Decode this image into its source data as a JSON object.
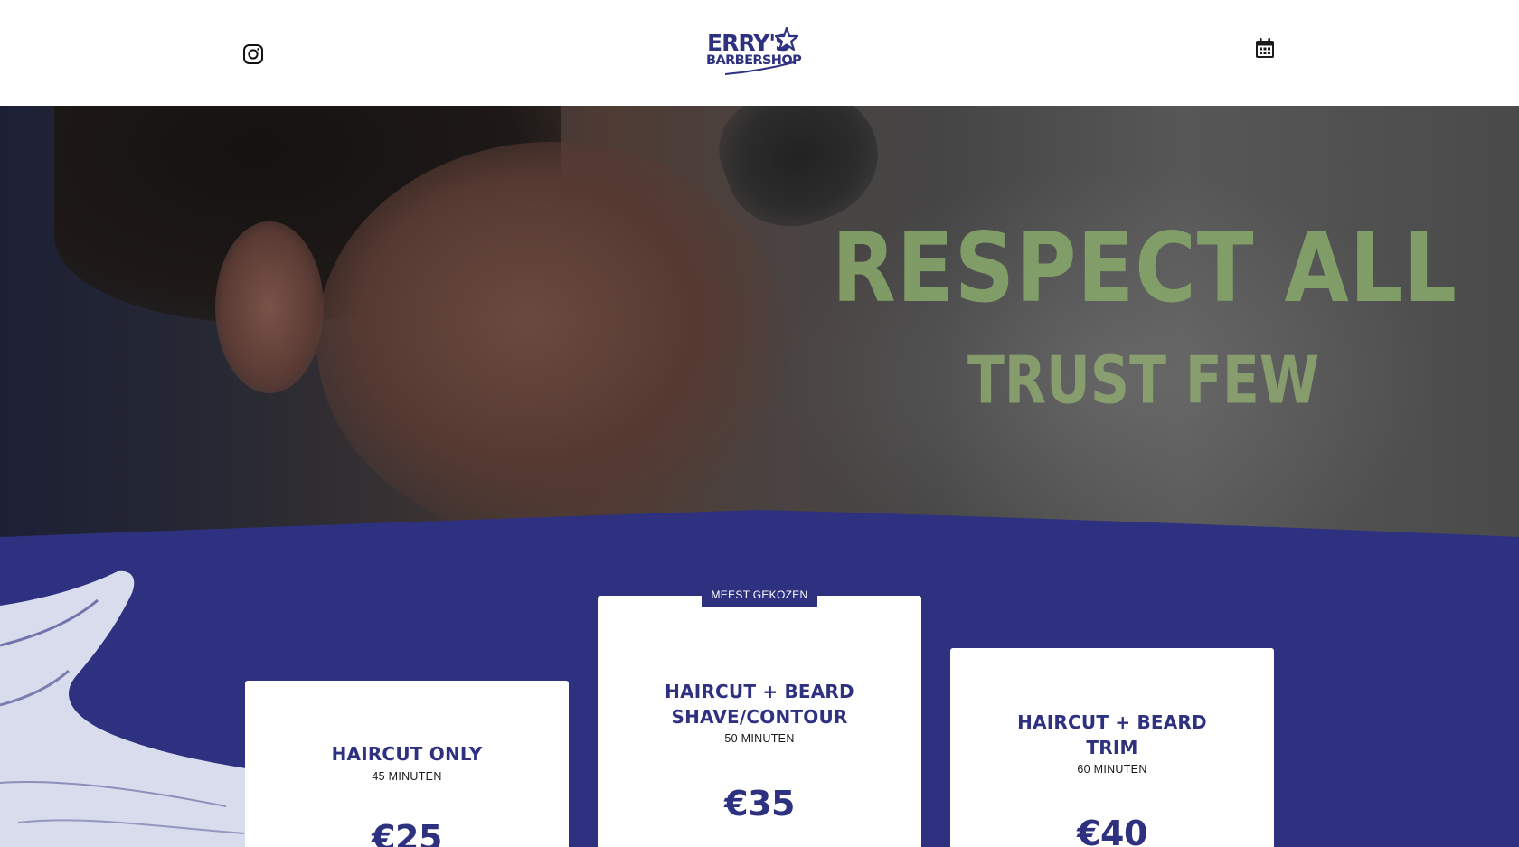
{
  "header": {
    "logo": {
      "line1": "ERRY'S",
      "line2": "BARBERSHOP"
    },
    "icons": {
      "left": "instagram-icon",
      "right": "calendar-icon"
    }
  },
  "hero": {
    "sign_line1": "RESPECT ALL",
    "sign_line2": "TRUST FEW"
  },
  "pricing": {
    "badge": "MEEST GEKOZEN",
    "cards": [
      {
        "title": "HAIRCUT ONLY",
        "duration": "45 MINUTEN",
        "price": "€25"
      },
      {
        "title_line1": "HAIRCUT + BEARD",
        "title_line2": "SHAVE/CONTOUR",
        "duration": "50 MINUTEN",
        "price": "€35"
      },
      {
        "title_line1": "HAIRCUT + BEARD",
        "title_line2": "TRIM",
        "duration": "60 MINUTEN",
        "price": "€40"
      }
    ]
  },
  "colors": {
    "brand": "#2e3180",
    "background_header": "#ffffff",
    "card": "#ffffff",
    "sign_text": "#86a56a"
  }
}
